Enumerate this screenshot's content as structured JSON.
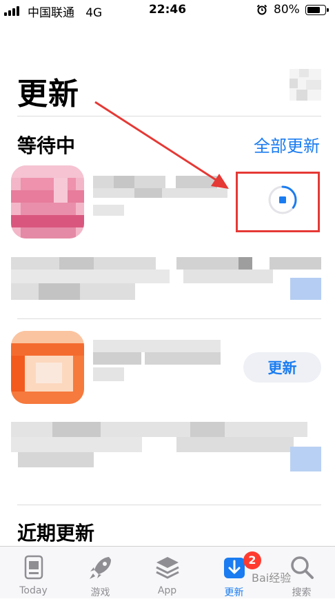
{
  "status_bar": {
    "carrier": "中国联通",
    "network": "4G",
    "time": "22:46",
    "battery": "80%",
    "battery_level": 0.8
  },
  "header": {
    "title": "更新"
  },
  "pending": {
    "title": "等待中",
    "update_all": "全部更新"
  },
  "app2": {
    "update_label": "更新"
  },
  "recent": {
    "title": "近期更新"
  },
  "tabs": [
    {
      "label": "Today",
      "icon": "today-icon"
    },
    {
      "label": "游戏",
      "icon": "rocket-icon"
    },
    {
      "label": "App",
      "icon": "app-stack-icon"
    },
    {
      "label": "更新",
      "icon": "update-download-icon",
      "badge": "2"
    },
    {
      "label": "搜索",
      "icon": "search-icon"
    }
  ],
  "watermark": "Bai经验",
  "colors": {
    "accent": "#1a7cf0",
    "badge": "#ff3b30",
    "annotation": "#e53935"
  }
}
